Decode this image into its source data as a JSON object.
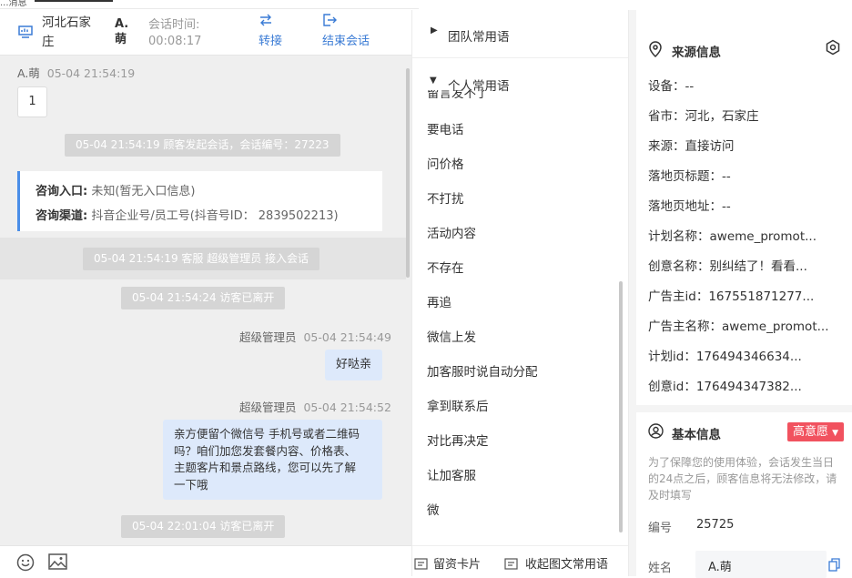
{
  "top_tab": {
    "stub": "...消息"
  },
  "header": {
    "location": "河北石家庄",
    "visitor_name": "A.萌",
    "session_time_label": "会话时间:",
    "session_time_value": "00:08:17",
    "transfer_label": "转接",
    "end_label": "结束会话"
  },
  "chat": {
    "msg1": {
      "name": "A.萌",
      "time": "05-04 21:54:19",
      "content": "1"
    },
    "sys1": "05-04 21:54:19 顾客发起会话，会话编号：27223",
    "card": {
      "entry_label": "咨询入口:",
      "entry_value": "未知(暂无入口信息)",
      "channel_label": "咨询渠道:",
      "channel_value": "抖音企业号/员工号(抖音号ID： 2839502213)"
    },
    "sys2": "05-04 21:54:19 客服 超级管理员 接入会话",
    "sys3": "05-04 21:54:24 访客已离开",
    "msg2": {
      "name": "超级管理员",
      "time": "05-04 21:54:49",
      "content": "好哒亲"
    },
    "msg3": {
      "name": "超级管理员",
      "time": "05-04 21:54:52",
      "lines": [
        "亲方便留个微信号 手机号或者二维码",
        "吗？咱们加您发套餐内容、价格表、",
        "主题客片和景点路线，您可以先了解",
        "一下哦"
      ]
    },
    "sys4": "05-04 22:01:04 访客已离开"
  },
  "footer": {
    "emoji_icon": "smile-icon",
    "image_icon": "image-icon"
  },
  "phrases": {
    "team_group": "团队常用语",
    "personal_group": "个人常用语",
    "partial_item": "留言发不了",
    "items": [
      "要电话",
      "问价格",
      "不打扰",
      "活动内容",
      "不存在",
      "再追",
      "微信上发",
      "加客服时说自动分配",
      "拿到联系后",
      "对比再决定",
      "让加客服",
      "微"
    ],
    "card_btn": "留资卡片",
    "collapse_btn": "收起图文常用语"
  },
  "source": {
    "title": "来源信息",
    "rows": [
      {
        "label": "设备：",
        "value": "--"
      },
      {
        "label": "省市：",
        "value": "河北，石家庄"
      },
      {
        "label": "来源：",
        "value": "直接访问"
      },
      {
        "label": "落地页标题：",
        "value": "--"
      },
      {
        "label": "落地页地址：",
        "value": "--"
      },
      {
        "label": "计划名称：",
        "value": "aweme_promot..."
      },
      {
        "label": "创意名称：",
        "value": "别纠结了！看看..."
      },
      {
        "label": "广告主id：",
        "value": "167551871277..."
      },
      {
        "label": "广告主名称：",
        "value": "aweme_promot..."
      },
      {
        "label": "计划id：",
        "value": "176494346634..."
      },
      {
        "label": "创意id：",
        "value": "176494347382..."
      }
    ]
  },
  "basic": {
    "title": "基本信息",
    "intent_badge": "高意愿",
    "note": "为了保障您的使用体验，会话发生当日的24点之后，顾客信息将无法修改，请及时填写",
    "id_label": "编号",
    "id_value": "25725",
    "name_label": "姓名",
    "name_value": "A.萌"
  },
  "colors": {
    "accent": "#3a7bd5",
    "badge": "#f1525f",
    "bubble": "#dde9fb"
  }
}
